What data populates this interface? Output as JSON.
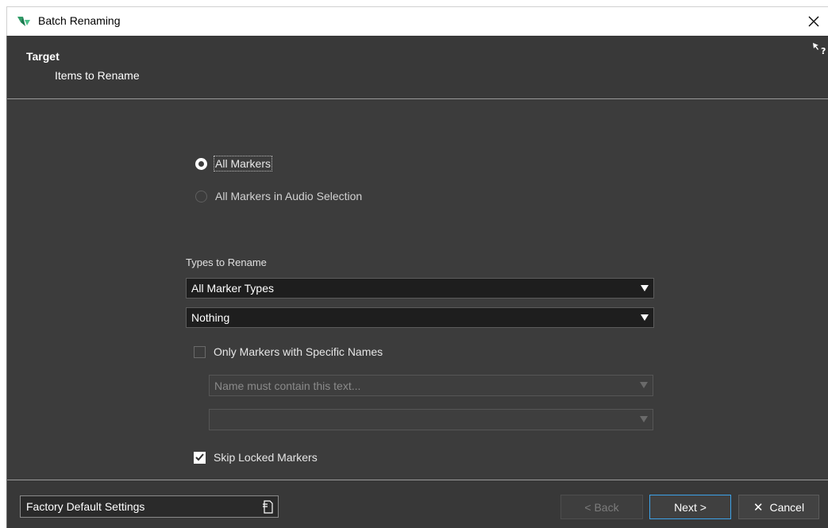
{
  "window": {
    "title": "Batch Renaming",
    "close_icon": "close-icon",
    "app_icon": "wavelab-logo-icon"
  },
  "header": {
    "title": "Target",
    "subtitle": "Items to Rename",
    "help_icon": "help-cursor-icon"
  },
  "target": {
    "options": [
      {
        "label": "All Markers",
        "selected": true
      },
      {
        "label": "All Markers in Audio Selection",
        "selected": false
      }
    ],
    "types_label": "Types to Rename",
    "types_select_1": "All Marker Types",
    "types_select_2": "Nothing",
    "specific_names": {
      "label": "Only Markers with Specific Names",
      "checked": false,
      "name_placeholder": "Name must contain this text...",
      "second_value": ""
    },
    "skip_locked": {
      "label": "Skip Locked Markers",
      "checked": true
    }
  },
  "footer": {
    "preset": "Factory Default Settings",
    "preset_icon": "preset-menu-icon",
    "back_label": "< Back",
    "next_label": "Next >",
    "cancel_label": "Cancel",
    "colors": {
      "focus_border": "#3da2e8"
    }
  }
}
